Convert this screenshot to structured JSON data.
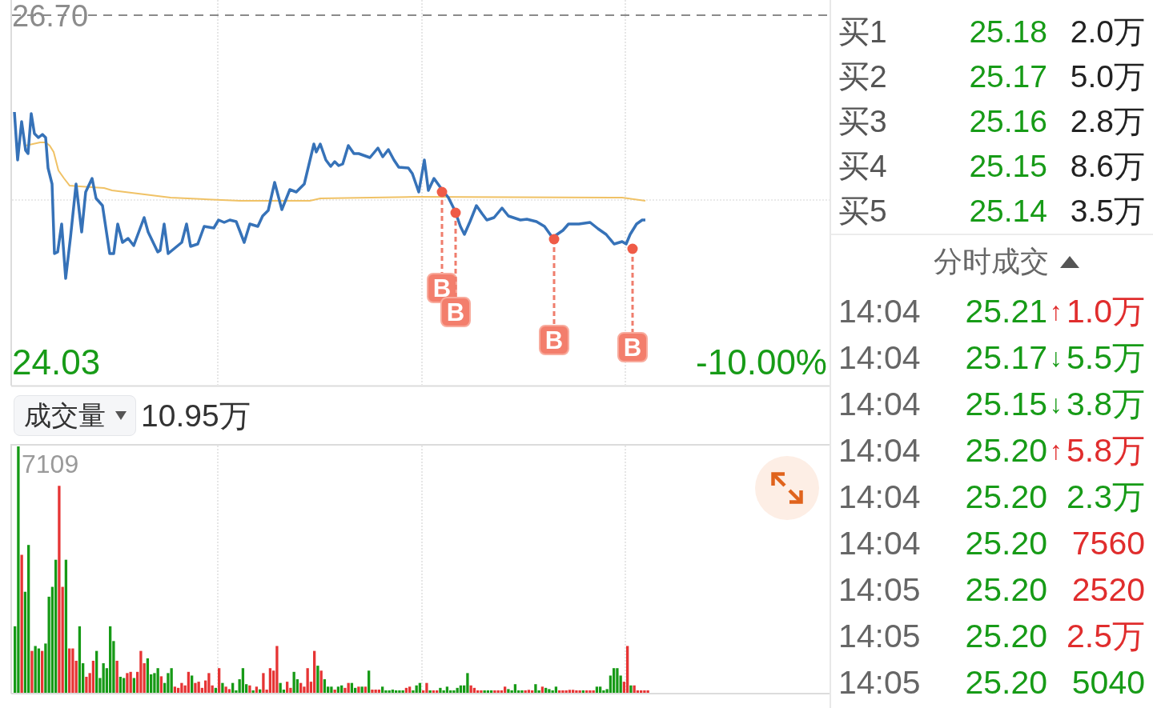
{
  "price_chart": {
    "top_price": "26.70",
    "bottom_price": "24.03",
    "bottom_change": "-10.00%",
    "signals": [
      {
        "label": "B"
      },
      {
        "label": "B"
      },
      {
        "label": "B"
      },
      {
        "label": "B"
      }
    ]
  },
  "volume_panel": {
    "indicator": "成交量",
    "total": "10.95万",
    "max_label": "7109"
  },
  "bids": [
    {
      "label": "买1",
      "price": "25.18",
      "volume": "2.0万"
    },
    {
      "label": "买2",
      "price": "25.17",
      "volume": "5.0万"
    },
    {
      "label": "买3",
      "price": "25.16",
      "volume": "2.8万"
    },
    {
      "label": "买4",
      "price": "25.15",
      "volume": "8.6万"
    },
    {
      "label": "买5",
      "price": "25.14",
      "volume": "3.5万"
    }
  ],
  "trade_list": {
    "title": "分时成交",
    "rows": [
      {
        "time": "14:04",
        "price": "25.21",
        "arrow": "↑",
        "volume": "1.0万",
        "color": "#e02d2d"
      },
      {
        "time": "14:04",
        "price": "25.17",
        "arrow": "↓",
        "volume": "5.5万",
        "color": "#179b17"
      },
      {
        "time": "14:04",
        "price": "25.15",
        "arrow": "↓",
        "volume": "3.8万",
        "color": "#179b17"
      },
      {
        "time": "14:04",
        "price": "25.20",
        "arrow": "↑",
        "volume": "5.8万",
        "color": "#e02d2d"
      },
      {
        "time": "14:04",
        "price": "25.20",
        "volume": "2.3万",
        "color": "#179b17"
      },
      {
        "time": "14:04",
        "price": "25.20",
        "volume": "7560",
        "color": "#e02d2d"
      },
      {
        "time": "14:05",
        "price": "25.20",
        "volume": "2520",
        "color": "#e02d2d"
      },
      {
        "time": "14:05",
        "price": "25.20",
        "volume": "2.5万",
        "color": "#e02d2d"
      },
      {
        "time": "14:05",
        "price": "25.20",
        "volume": "5040",
        "color": "#179b17"
      }
    ]
  }
}
